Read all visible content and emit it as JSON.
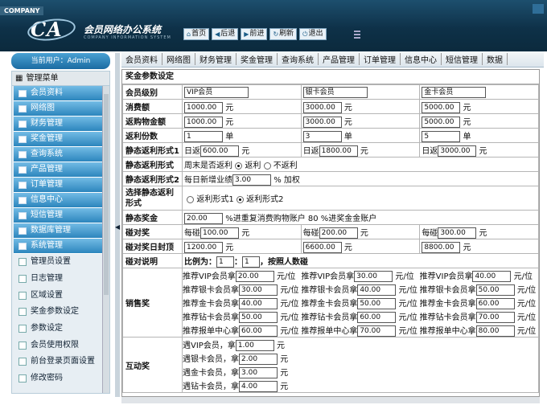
{
  "header": {
    "brand": "COMPANY",
    "logo": "CA",
    "title": "会员网络办公系统",
    "subtitle": "COMPANY INFORMATION SYSTEM",
    "nav": [
      {
        "label": "首页",
        "icon": "home-icon"
      },
      {
        "label": "后退",
        "icon": "back-arrow-icon"
      },
      {
        "label": "前进",
        "icon": "forward-arrow-icon"
      },
      {
        "label": "刷新",
        "icon": "refresh-icon"
      },
      {
        "label": "退出",
        "icon": "power-icon"
      }
    ]
  },
  "user": {
    "label": "当前用户：Admin"
  },
  "sidebar": {
    "title": "管理菜单",
    "items": [
      "会员资料",
      "网络图",
      "财务管理",
      "奖金管理",
      "查询系统",
      "产品管理",
      "订单管理",
      "信息中心",
      "短信管理",
      "数据库管理",
      "系统管理"
    ],
    "subitems": [
      "管理员设置",
      "日志管理",
      "区域设置",
      "奖金参数设定",
      "参数设定",
      "会员使用权限",
      "前台登录页面设置",
      "修改密码"
    ]
  },
  "tabs": [
    "会员资料",
    "网络图",
    "财务管理",
    "奖金管理",
    "查询系统",
    "产品管理",
    "订单管理",
    "信息中心",
    "短信管理",
    "数据"
  ],
  "content": {
    "title": "奖金参数设定",
    "level": {
      "label": "会员级别",
      "v1": "VIP会员",
      "v2": "银卡会员",
      "v3": "金卡会员"
    },
    "fee": {
      "label": "消费额",
      "v1": "1000.00",
      "v2": "3000.00",
      "v3": "5000.00",
      "unit": "元"
    },
    "rebate_amt": {
      "label": "返购物金额",
      "v1": "1000.00",
      "v2": "3000.00",
      "v3": "5000.00",
      "unit": "元"
    },
    "rebate_cnt": {
      "label": "返利份数",
      "v1": "1",
      "v2": "3",
      "v3": "5",
      "unit": "单"
    },
    "static1": {
      "label": "静态返利形式1",
      "prefix": "日返",
      "v1": "600.00",
      "v2": "1800.00",
      "v3": "3000.00",
      "unit": "元"
    },
    "static_mode": {
      "label": "静态返利形式",
      "text": "周末是否返利",
      "opt1": "返利",
      "opt2": "不返利"
    },
    "static2": {
      "label": "静态返利形式2",
      "text": "每日新增业绩",
      "value": "3.00",
      "suffix": "% 加权"
    },
    "choose": {
      "label": "选择静态返利形式",
      "opt1": "返利形式1",
      "opt2": "返利形式2"
    },
    "static_bonus": {
      "label": "静态奖金",
      "value": "20.00",
      "text": "%进重复消费购物账户 80 %进奖金金账户"
    },
    "collide": {
      "label": "碰对奖",
      "prefix": "每碰",
      "v1": "100.00",
      "v2": "200.00",
      "v3": "300.00",
      "unit": "元"
    },
    "collide_cap": {
      "label": "碰对奖日封顶",
      "v1": "1200.00",
      "v2": "6600.00",
      "v3": "8800.00",
      "unit": "元"
    },
    "collide_note": {
      "label": "碰对说明",
      "text1": "比例为：",
      "a": "1",
      "b": "1",
      "text2": "，按照人数碰"
    },
    "sales": {
      "label": "销售奖",
      "unit": "元/位",
      "rows": [
        [
          "推荐VIP会员拿",
          "20.00",
          "推荐VIP会员拿",
          "30.00",
          "推荐VIP会员拿",
          "40.00"
        ],
        [
          "推荐银卡会员拿",
          "30.00",
          "推荐银卡会员拿",
          "40.00",
          "推荐银卡会员拿",
          "50.00"
        ],
        [
          "推荐金卡会员拿",
          "40.00",
          "推荐金卡会员拿",
          "50.00",
          "推荐金卡会员拿",
          "60.00"
        ],
        [
          "推荐钻卡会员拿",
          "50.00",
          "推荐钻卡会员拿",
          "60.00",
          "推荐钻卡会员拿",
          "70.00"
        ],
        [
          "推荐报单中心拿",
          "60.00",
          "推荐报单中心拿",
          "70.00",
          "推荐报单中心拿",
          "80.00"
        ]
      ]
    },
    "interact": {
      "label": "互动奖",
      "unit": "元",
      "rows": [
        [
          "遇VIP会员，拿",
          "1.00"
        ],
        [
          "遇银卡会员，拿",
          "2.00"
        ],
        [
          "遇金卡会员，拿",
          "3.00"
        ],
        [
          "遇钻卡会员，拿",
          "4.00"
        ]
      ]
    }
  }
}
